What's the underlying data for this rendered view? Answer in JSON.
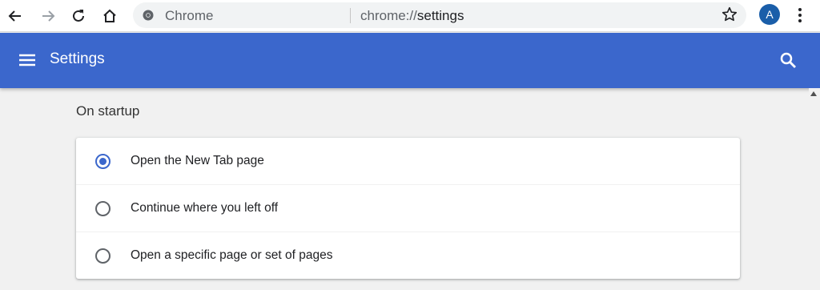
{
  "browser": {
    "site_name": "Chrome",
    "url_scheme": "chrome://",
    "url_path": "settings",
    "avatar_letter": "A"
  },
  "header": {
    "title": "Settings"
  },
  "startup": {
    "section_title": "On startup",
    "options": [
      {
        "label": "Open the New Tab page",
        "checked": true
      },
      {
        "label": "Continue where you left off",
        "checked": false
      },
      {
        "label": "Open a specific page or set of pages",
        "checked": false
      }
    ]
  },
  "colors": {
    "accent": "#3b67cc",
    "avatar": "#1a5ea9"
  }
}
